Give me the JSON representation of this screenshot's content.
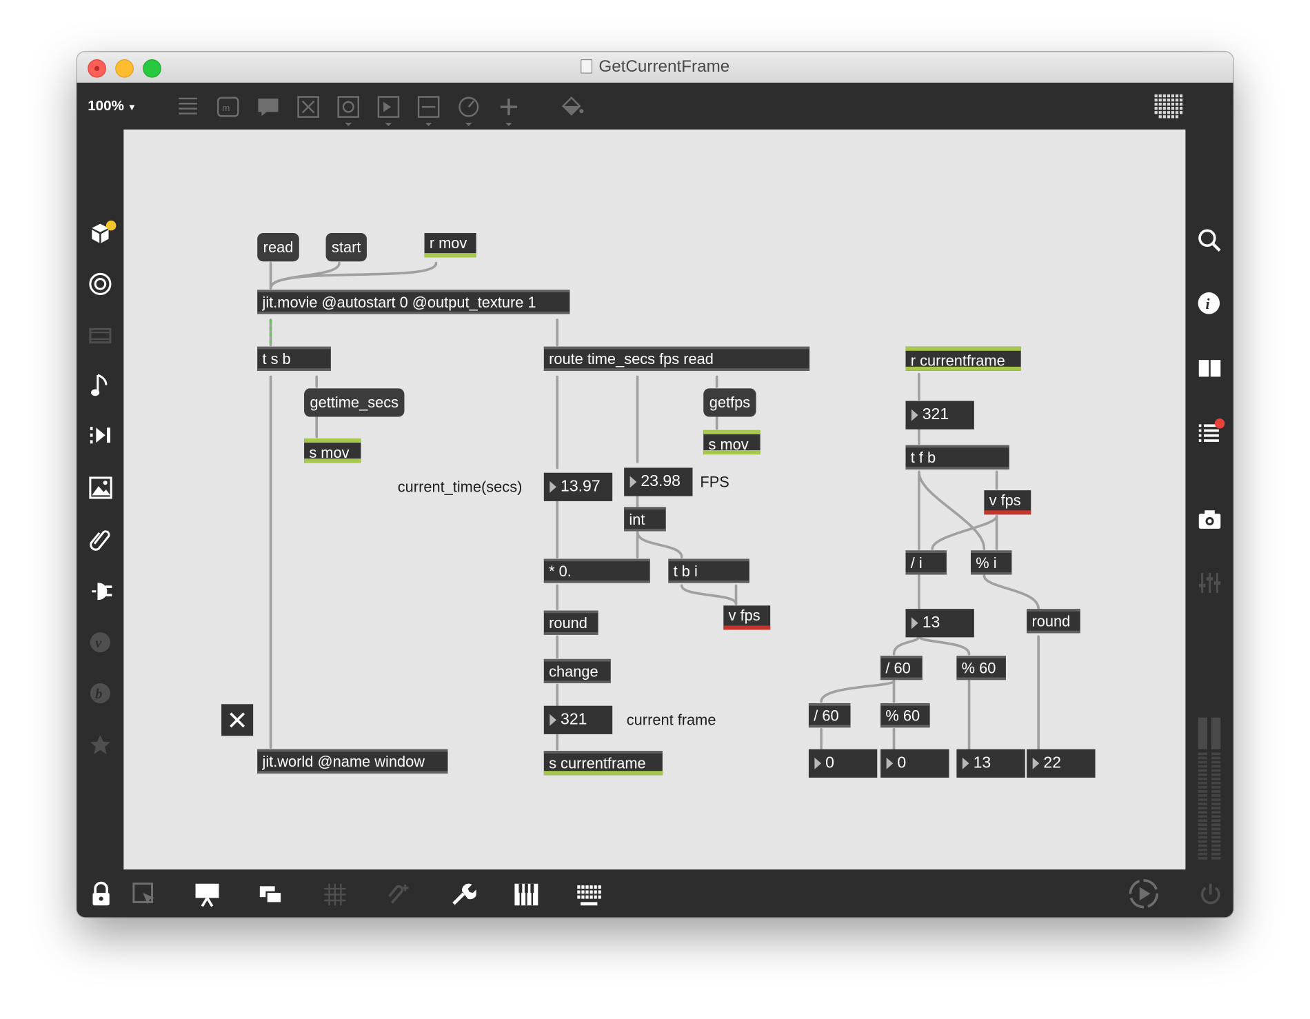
{
  "window": {
    "title": "GetCurrentFrame"
  },
  "toolbar": {
    "zoom": "100%",
    "icons": [
      "object-list-icon",
      "message-box-icon",
      "comment-icon",
      "toggle-icon",
      "button-icon",
      "number-box-icon",
      "slider-icon",
      "dial-icon",
      "add-object-icon",
      "paint-bucket-icon"
    ],
    "grid_icon": "grid-display-icon"
  },
  "left_sidebar": {
    "icons": [
      "package-icon",
      "target-icon",
      "video-icon",
      "music-note-icon",
      "playback-icon",
      "image-icon",
      "clip-icon",
      "plugin-icon",
      "vimeo-icon",
      "beat-icon",
      "star-icon"
    ]
  },
  "right_sidebar": {
    "icons": [
      "search-icon",
      "info-icon",
      "book-icon",
      "console-icon",
      "snapshot-icon",
      "mixer-icon"
    ]
  },
  "bottom_bar": {
    "icons": [
      "lock-icon",
      "edit-select-icon",
      "presentation-icon",
      "windows-icon",
      "grid-icon",
      "snap-icon",
      "wrench-icon",
      "keyboard-piano-icon",
      "keyboard-icon",
      "transport-play-icon",
      "power-icon"
    ]
  },
  "patch": {
    "msg_read": "read",
    "msg_start": "start",
    "obj_r_mov": "r mov",
    "obj_jitmovie": "jit.movie @autostart 0 @output_texture 1",
    "obj_tsb": "t s b",
    "msg_gettime": "gettime_secs",
    "obj_s_mov1": "s mov",
    "obj_route": "route time_secs fps read",
    "msg_getfps": "getfps",
    "obj_s_mov2": "s mov",
    "comment_time": "current_time(secs)",
    "num_time": "13.97",
    "num_fps": "23.98",
    "comment_fps": "FPS",
    "obj_int": "int",
    "obj_mul": "* 0.",
    "obj_tbi": "t b i",
    "obj_vfps1": "v fps",
    "obj_round1": "round",
    "obj_change": "change",
    "num_frame": "321",
    "comment_frame": "current frame",
    "obj_s_currentframe": "s currentframe",
    "obj_jitworld": "jit.world @name window",
    "obj_r_currentframe": "r currentframe",
    "num_321": "321",
    "obj_tfb": "t f b",
    "obj_vfps2": "v fps",
    "obj_div_i": "/ i",
    "obj_mod_i": "% i",
    "num_13a": "13",
    "obj_round2": "round",
    "obj_div60a": "/ 60",
    "obj_mod60a": "% 60",
    "obj_div60b": "/ 60",
    "obj_mod60b": "% 60",
    "num_0a": "0",
    "num_0b": "0",
    "num_13b": "13",
    "num_22": "22"
  }
}
